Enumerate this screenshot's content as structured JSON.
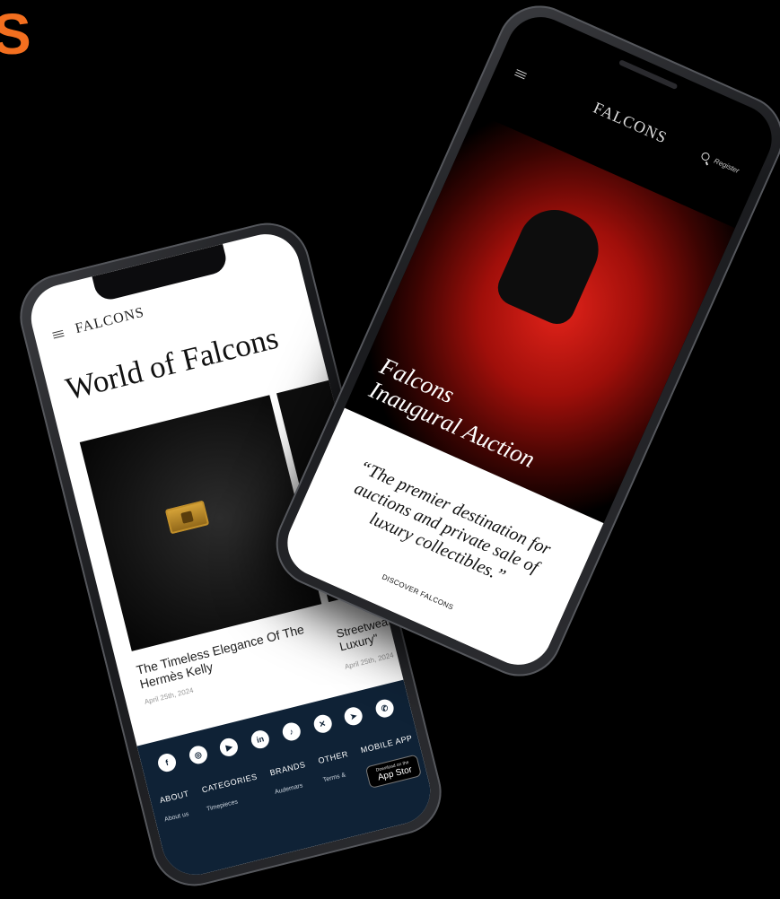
{
  "corner_letter": "S",
  "left_phone": {
    "brand": "FALCONS",
    "heading": "World of Falcons",
    "articles": [
      {
        "title": "The Timeless Elegance Of The Hermès Kelly",
        "date": "April 25th, 2024"
      },
      {
        "title": "Streetwear Luxury\"",
        "date": "April 25th, 2024"
      }
    ],
    "footer": {
      "social_icons": [
        {
          "name": "facebook-icon",
          "glyph": "f"
        },
        {
          "name": "instagram-icon",
          "glyph": "◎"
        },
        {
          "name": "youtube-icon",
          "glyph": "▶"
        },
        {
          "name": "linkedin-icon",
          "glyph": "in"
        },
        {
          "name": "tiktok-icon",
          "glyph": "♪"
        },
        {
          "name": "x-icon",
          "glyph": "✕"
        },
        {
          "name": "telegram-icon",
          "glyph": "➤"
        },
        {
          "name": "whatsapp-icon",
          "glyph": "✆"
        }
      ],
      "columns": [
        {
          "heading": "ABOUT",
          "link": "About us"
        },
        {
          "heading": "CATEGORIES",
          "link": "Timepieces"
        },
        {
          "heading": "BRANDS",
          "link": "Audemars"
        },
        {
          "heading": "OTHER",
          "link": "Terms &"
        },
        {
          "heading": "MOBILE APP",
          "link": ""
        }
      ],
      "app_store_small": "Download on the",
      "app_store_label": "App Stor"
    }
  },
  "right_phone": {
    "brand": "FALCONS",
    "register": "Register",
    "hero_title_line1": "Falcons",
    "hero_title_line2": "Inaugural Auction",
    "quote": "“The premier destination for auctions and private sale of luxury collectibles.”",
    "cta": "DISCOVER FALCONS"
  }
}
